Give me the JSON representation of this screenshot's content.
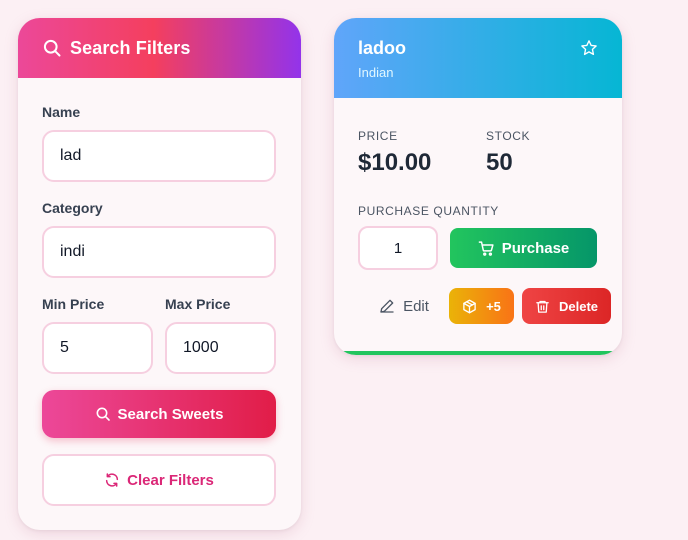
{
  "filters": {
    "title": "Search Filters",
    "name_label": "Name",
    "name_value": "lad",
    "category_label": "Category",
    "category_value": "indi",
    "min_price_label": "Min Price",
    "min_price_value": "5",
    "max_price_label": "Max Price",
    "max_price_value": "1000",
    "search_button": "Search Sweets",
    "clear_button": "Clear Filters",
    "header_icon": "search-icon"
  },
  "card": {
    "name": "ladoo",
    "category": "Indian",
    "price_label": "PRICE",
    "price_value": "$10.00",
    "stock_label": "STOCK",
    "stock_value": "50",
    "quantity_label": "PURCHASE QUANTITY",
    "quantity_value": "1",
    "purchase_button": "Purchase",
    "edit_button": "Edit",
    "restock_button": "+5",
    "delete_button": "Delete",
    "favorite_icon": "star-icon",
    "stock_level": 1.0
  },
  "colors": {
    "filters_header_gradient": [
      "#ec4899",
      "#f43f5e",
      "#9333ea"
    ],
    "card_header_gradient": [
      "#60a5fa",
      "#06b6d4"
    ],
    "purchase": "#22c55e",
    "restock": "#f59e0b",
    "delete": "#ef4444",
    "stock_bar": "#22c55e",
    "page_background": "#fcf0f4"
  }
}
